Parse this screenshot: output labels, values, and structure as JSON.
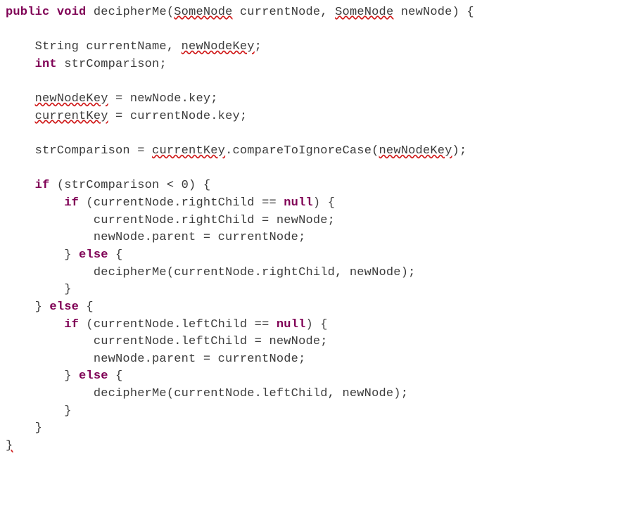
{
  "code": {
    "kw_public": "public",
    "kw_void": "void",
    "fn_name": "decipherMe",
    "type_SomeNode1": "SomeNode",
    "param_currentNode": "currentNode",
    "type_SomeNode2": "SomeNode",
    "param_newNode": "newNode",
    "brace_open_hdr": ") {",
    "decl_string": "    String currentName, ",
    "id_newNodeKey_decl": "newNodeKey",
    "semicolon1": ";",
    "kw_int": "int",
    "decl_strComparison": " strComparison;",
    "assign1_lhs": "newNodeKey",
    "assign1_rhs": " = newNode.key;",
    "assign2_lhs": "currentKey",
    "assign2_rhs": " = currentNode.key;",
    "strComp_lhs": "    strComparison = ",
    "strComp_currentKey": "currentKey",
    "strComp_rest": ".compareToIgnoreCase(",
    "strComp_arg": "newNodeKey",
    "strComp_end": ");",
    "kw_if1": "if",
    "if1_cond": " (strComparison < 0) {",
    "kw_if2": "if",
    "if2_cond": " (currentNode.rightChild == ",
    "kw_null1": "null",
    "if2_end": ") {",
    "stmt_r1": "            currentNode.rightChild = newNode;",
    "stmt_r2": "            newNode.parent = currentNode;",
    "brace_close1": "        } ",
    "kw_else1": "else",
    "else1_open": " {",
    "stmt_rec_r": "            decipherMe(currentNode.rightChild, newNode);",
    "brace_close2": "        }",
    "brace_close3": "    } ",
    "kw_else2": "else",
    "else2_open": " {",
    "kw_if3": "if",
    "if3_cond": " (currentNode.leftChild == ",
    "kw_null2": "null",
    "if3_end": ") {",
    "stmt_l1": "            currentNode.leftChild = newNode;",
    "stmt_l2": "            newNode.parent = currentNode;",
    "brace_close4": "        } ",
    "kw_else3": "else",
    "else3_open": " {",
    "stmt_rec_l": "            decipherMe(currentNode.leftChild, newNode);",
    "brace_close5": "        }",
    "brace_close6": "    }",
    "brace_close7": "}",
    "sp": " ",
    "comma_sp": ", ",
    "paren_open": "(",
    "indent4": "    ",
    "indent8": "        "
  }
}
